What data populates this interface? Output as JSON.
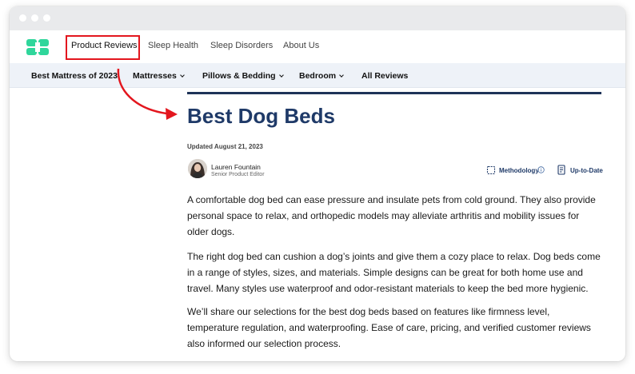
{
  "colors": {
    "accent": "#1f3a68",
    "highlight": "#e3161e",
    "logo": "#2fd69b",
    "subnav_bg": "#eef2f8"
  },
  "topnav": {
    "logo_icon": "brand-logo-icon",
    "items": [
      {
        "label": "Product Reviews",
        "highlighted": true
      },
      {
        "label": "Sleep Health"
      },
      {
        "label": "Sleep Disorders"
      },
      {
        "label": "About Us"
      }
    ]
  },
  "subnav": {
    "items": [
      {
        "label": "Best Mattress of 2023",
        "dropdown": false
      },
      {
        "label": "Mattresses",
        "dropdown": true
      },
      {
        "label": "Pillows & Bedding",
        "dropdown": true
      },
      {
        "label": "Bedroom",
        "dropdown": true
      },
      {
        "label": "All Reviews",
        "dropdown": false
      }
    ]
  },
  "article": {
    "title": "Best Dog Beds",
    "updated": "Updated August 21, 2023",
    "author": {
      "name": "Lauren Fountain",
      "role": "Senior Product Editor"
    },
    "methodology_label": "Methodology",
    "uptodate_label": "Up-to-Date",
    "paragraphs": [
      "A comfortable dog bed can ease pressure and insulate pets from cold ground. They also provide personal space to relax, and orthopedic models may alleviate arthritis and mobility issues for older dogs.",
      "The right dog bed can cushion a dog’s joints and give them a cozy place to relax. Dog beds come in a range of styles, sizes, and materials. Simple designs can be great for both home use and travel. Many styles use waterproof and odor-resistant materials to keep the bed more hygienic.",
      "We’ll share our selections for the best dog beds based on features like firmness level, temperature regulation, and waterproofing. Ease of care, pricing, and verified customer reviews also informed our selection process."
    ]
  }
}
